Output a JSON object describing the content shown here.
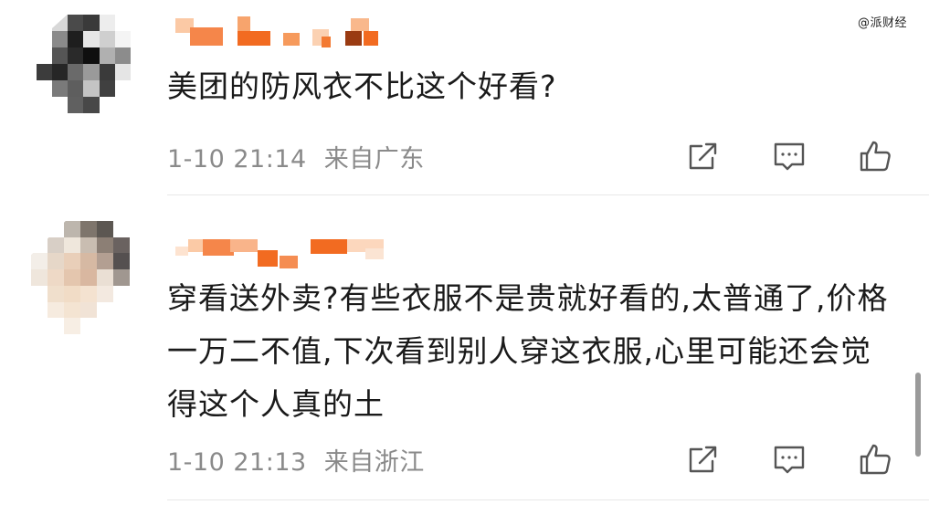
{
  "watermark": "@派财经",
  "comments": [
    {
      "text": "美团的防风衣不比这个好看?",
      "date": "1-10 21:14",
      "location": "来自广东"
    },
    {
      "text": "穿看送外卖?有些衣服不是贵就好看的,太普通了,价格一万二不值,下次看到别人穿这衣服,心里可能还会觉得这个人真的土",
      "date": "1-10 21:13",
      "location": "来自浙江"
    }
  ],
  "icons": {
    "share": "share-icon",
    "reply": "comment-icon",
    "like": "thumbs-up-icon"
  },
  "colors": {
    "text": "#1a1a1a",
    "meta": "#8a8a8a",
    "name_orange": "#f26b21",
    "icon": "#555555"
  }
}
